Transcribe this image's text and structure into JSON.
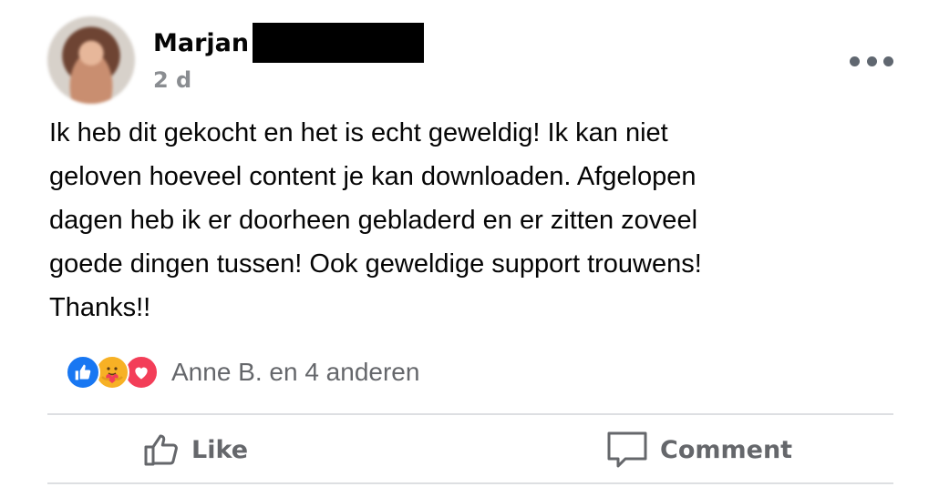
{
  "post": {
    "author": {
      "first_name": "Marjan",
      "avatar_icon": "avatar-photo"
    },
    "timestamp": "2 d",
    "options_icon": "more-options-icon",
    "text": "Ik heb dit gekocht en het is echt geweldig! Ik kan niet\ngeloven hoeveel content je kan downloaden. Afgelopen\ndagen heb ik er doorheen gebladerd en er zitten zoveel\ngoede dingen tussen! Ook geweldige support trouwens!\nThanks!!"
  },
  "reactions": {
    "icons": [
      "like-reaction-icon",
      "care-reaction-icon",
      "love-reaction-icon"
    ],
    "summary": "Anne B. en 4 anderen"
  },
  "actions": {
    "like_label": "Like",
    "comment_label": "Comment"
  },
  "colors": {
    "like_blue": "#1877f2",
    "love_red": "#f33e58",
    "care_yellow": "#f7b125",
    "secondary_text": "#65676b",
    "timestamp_gray": "#8a8d91"
  }
}
